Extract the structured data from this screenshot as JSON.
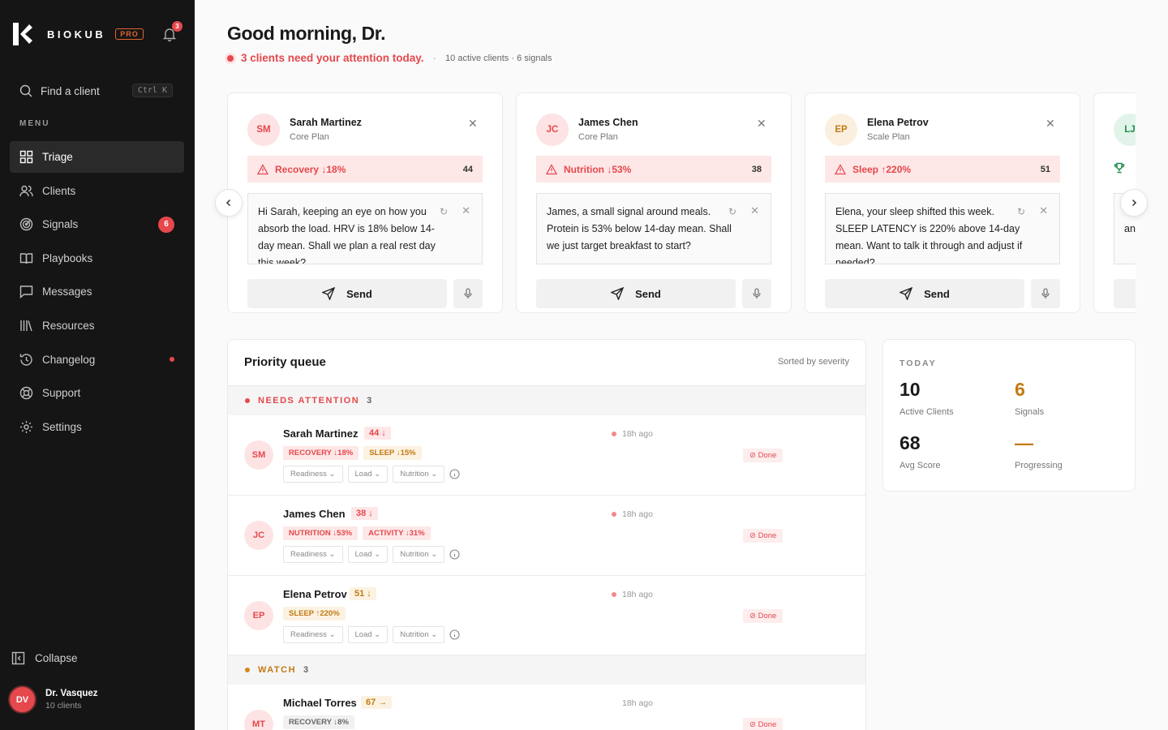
{
  "app": {
    "brand": "BIOKUB",
    "badge": "PRO",
    "notifications": "3"
  },
  "search": {
    "label": "Find a client",
    "shortcut": "Ctrl K"
  },
  "menu_label": "MENU",
  "nav": [
    {
      "label": "Triage",
      "icon": "grid-icon"
    },
    {
      "label": "Clients",
      "icon": "users-icon"
    },
    {
      "label": "Signals",
      "icon": "radar-icon",
      "badge": "6"
    },
    {
      "label": "Playbooks",
      "icon": "book-icon"
    },
    {
      "label": "Messages",
      "icon": "message-icon"
    },
    {
      "label": "Resources",
      "icon": "library-icon"
    },
    {
      "label": "Changelog",
      "icon": "history-icon"
    },
    {
      "label": "Support",
      "icon": "lifebuoy-icon"
    },
    {
      "label": "Settings",
      "icon": "gear-icon"
    }
  ],
  "collapse_label": "Collapse",
  "user": {
    "initials": "DV",
    "name": "Dr. Vasquez",
    "sub": "10 clients"
  },
  "header": {
    "greeting": "Good morning, Dr.",
    "attention": "3 clients need your attention today.",
    "meta": "10 active clients · 6 signals"
  },
  "cards": [
    {
      "initials": "SM",
      "name": "Sarah Martinez",
      "plan": "Core Plan",
      "alert": "Recovery ↓18%",
      "score": "44",
      "message": "Hi Sarah, keeping an eye on how you absorb the load. HRV is 18% below 14-day mean. Shall we plan a real rest day this week?",
      "send": "Send"
    },
    {
      "initials": "JC",
      "name": "James Chen",
      "plan": "Core Plan",
      "alert": "Nutrition ↓53%",
      "score": "38",
      "message": "James, a small signal around meals. Protein is 53% below 14-day mean. Shall we just target breakfast to start?",
      "send": "Send"
    },
    {
      "initials": "EP",
      "name": "Elena Petrov",
      "plan": "Scale Plan",
      "alert": "Sleep ↑220%",
      "score": "51",
      "message": "Elena, your sleep shifted this week. SLEEP LATENCY is 220% above 14-day mean. Want to talk it through and adjust if needed?",
      "send": "Send"
    },
    {
      "initials": "LJ",
      "name": "",
      "plan": "",
      "alert": "",
      "score": "",
      "message": "an litt",
      "send": ""
    }
  ],
  "queue": {
    "title": "Priority queue",
    "sort": "Sorted by severity",
    "done_label": "Done",
    "selects": [
      "Readiness",
      "Load",
      "Nutrition"
    ],
    "groups": [
      {
        "label": "NEEDS ATTENTION",
        "count": "3",
        "color": "#e5484d"
      },
      {
        "label": "WATCH",
        "count": "3",
        "color": "#d4891a"
      }
    ],
    "rows": [
      {
        "initials": "SM",
        "name": "Sarah Martinez",
        "score": "44 ↓",
        "time": "18h ago",
        "chips": [
          "RECOVERY ↓18%",
          "SLEEP ↓15%"
        ]
      },
      {
        "initials": "JC",
        "name": "James Chen",
        "score": "38 ↓",
        "time": "18h ago",
        "chips": [
          "NUTRITION ↓53%",
          "ACTIVITY ↓31%"
        ]
      },
      {
        "initials": "EP",
        "name": "Elena Petrov",
        "score": "51 ↓",
        "time": "18h ago",
        "chips": [
          "SLEEP ↑220%"
        ]
      },
      {
        "initials": "MT",
        "name": "Michael Torres",
        "score": "67 →",
        "time": "18h ago",
        "chips": [
          "RECOVERY ↓8%"
        ]
      }
    ]
  },
  "today": {
    "label": "TODAY",
    "stats": [
      {
        "value": "10",
        "label": "Active Clients"
      },
      {
        "value": "6",
        "label": "Signals"
      },
      {
        "value": "68",
        "label": "Avg Score"
      },
      {
        "value": "—",
        "label": "Progressing"
      }
    ]
  },
  "colors": {
    "accent": "#e5484d",
    "amber": "#c27a12",
    "sidebar": "#151515"
  }
}
